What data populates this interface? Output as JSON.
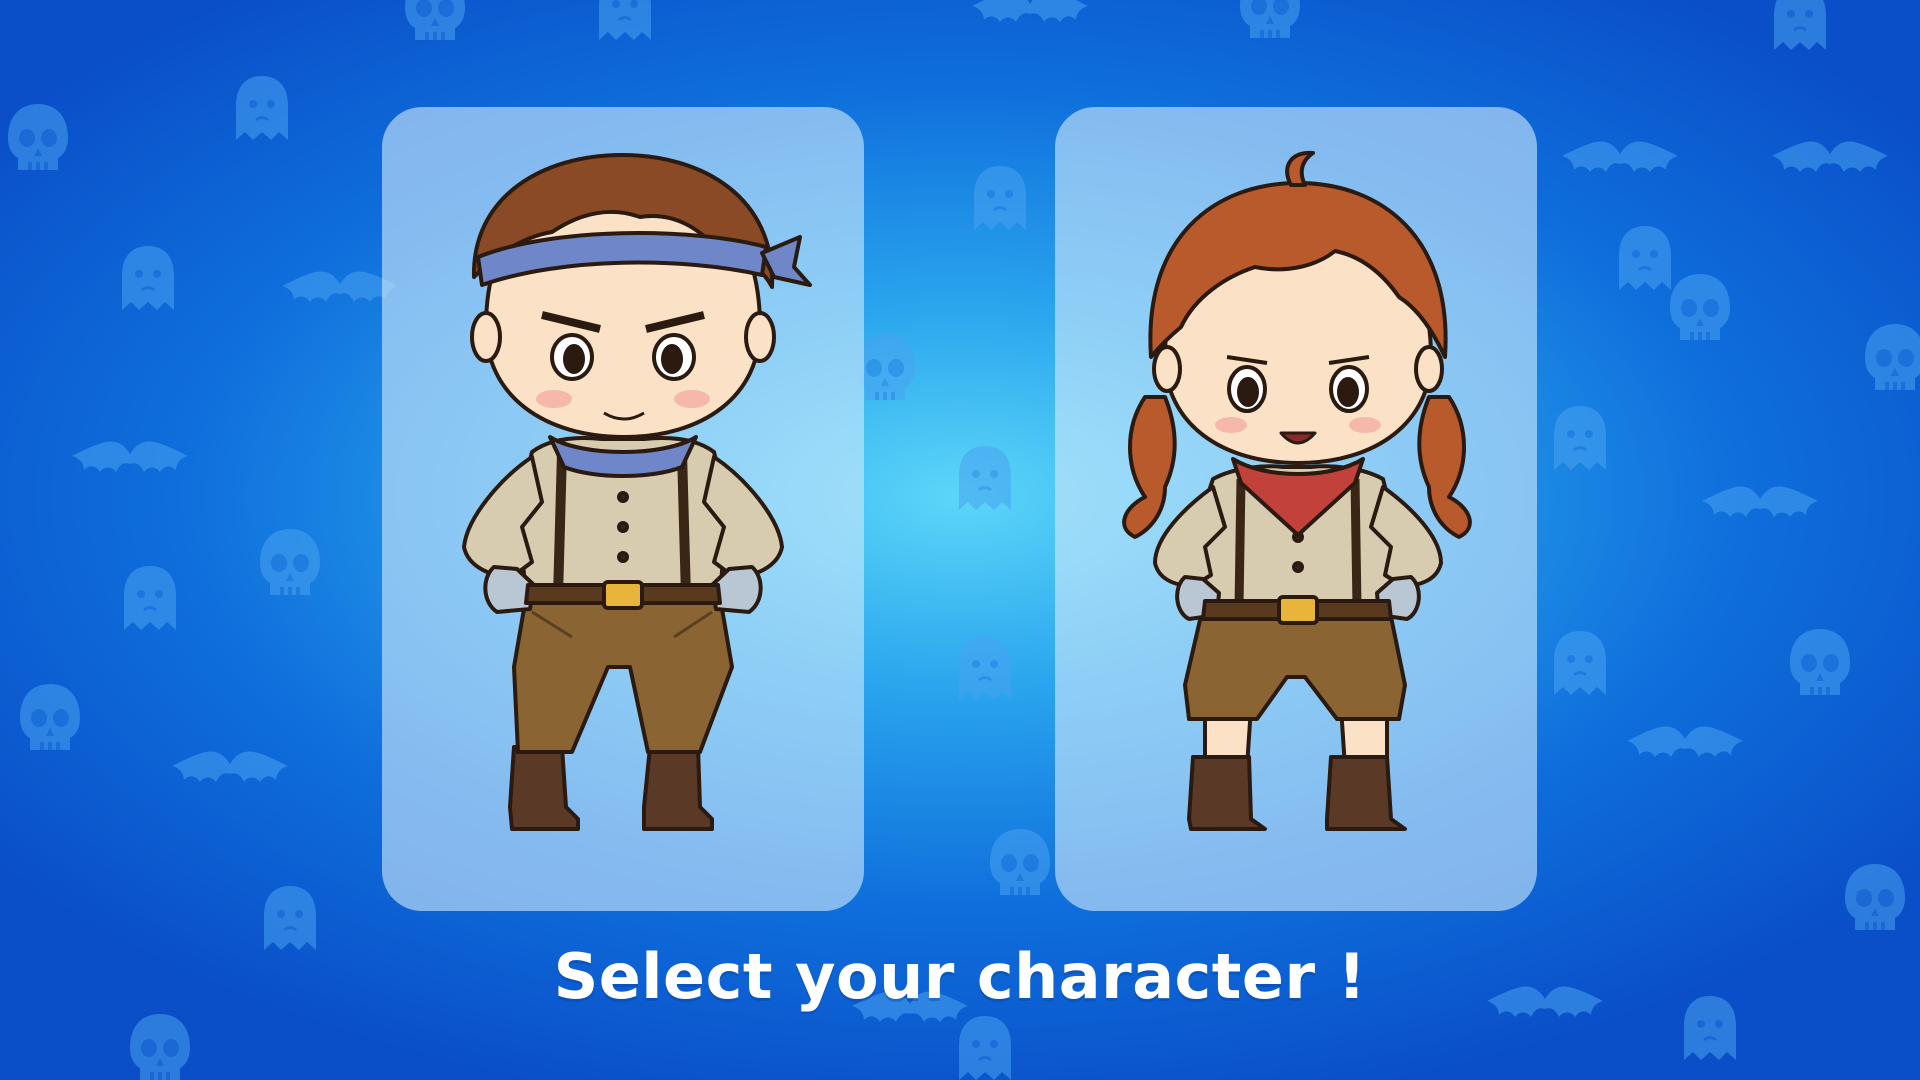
{
  "screen": {
    "title": "Select your character !"
  },
  "characters": [
    {
      "icon": "boy-character-icon",
      "bandana_color": "#6f86c8",
      "hair_color": "#8a4a25"
    },
    {
      "icon": "girl-character-icon",
      "bandana_color": "#c2413a",
      "hair_color": "#b95a2c"
    }
  ],
  "colors": {
    "background_center": "#5cd6f8",
    "background_edge": "#0a4fc8",
    "card_fill": "#cde8fc",
    "title_text": "#ffffff"
  },
  "background_icons": [
    "ghost-icon",
    "skull-icon",
    "bat-icon"
  ]
}
